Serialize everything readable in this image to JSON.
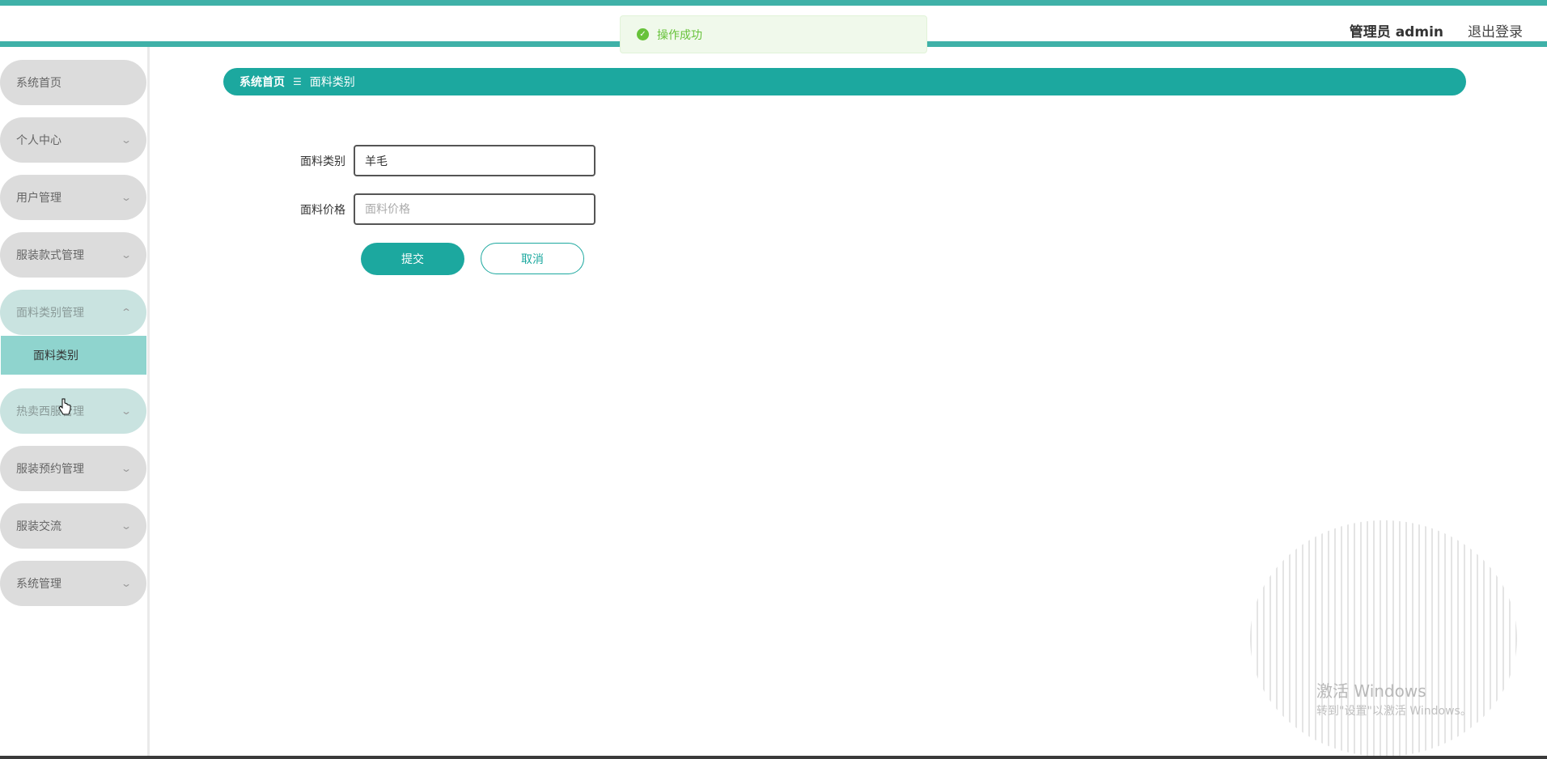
{
  "header": {
    "user_label": "管理员 admin",
    "logout_label": "退出登录"
  },
  "toast": {
    "message": "操作成功"
  },
  "sidebar": {
    "items": [
      {
        "label": "系统首页"
      },
      {
        "label": "个人中心"
      },
      {
        "label": "用户管理"
      },
      {
        "label": "服装款式管理"
      },
      {
        "label": "面料类别管理"
      },
      {
        "label": "热卖西服管理"
      },
      {
        "label": "服装预约管理"
      },
      {
        "label": "服装交流"
      },
      {
        "label": "系统管理"
      }
    ],
    "submenu": {
      "label": "面料类别"
    }
  },
  "breadcrumb": {
    "home": "系统首页",
    "separator": "☰",
    "current": "面料类别"
  },
  "form": {
    "category_label": "面料类别",
    "category_value": "羊毛",
    "price_label": "面料价格",
    "price_placeholder": "面料价格",
    "submit_label": "提交",
    "cancel_label": "取消"
  },
  "watermark": {
    "title": "激活 Windows",
    "subtitle": "转到\"设置\"以激活 Windows。"
  },
  "colors": {
    "accent": "#1ca89f",
    "stripe": "#3fb1a8",
    "toast_green": "#67c23a"
  }
}
